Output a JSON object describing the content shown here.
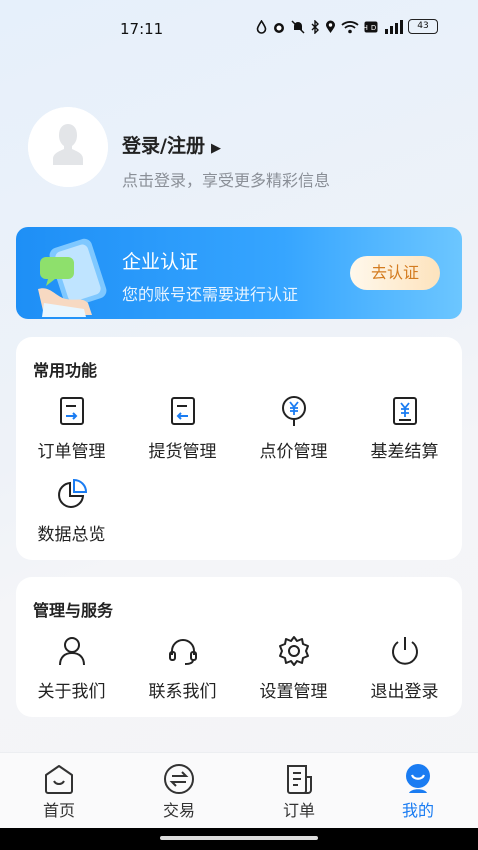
{
  "status_bar": {
    "time": "17:11",
    "battery": "43"
  },
  "profile": {
    "title": "登录/注册",
    "subtitle": "点击登录，享受更多精彩信息"
  },
  "verify": {
    "title": "企业认证",
    "desc": "您的账号还需要进行认证",
    "button": "去认证"
  },
  "common": {
    "title": "常用功能",
    "items": [
      {
        "label": "订单管理",
        "icon": "order-doc-icon"
      },
      {
        "label": "提货管理",
        "icon": "pickup-doc-icon"
      },
      {
        "label": "点价管理",
        "icon": "price-pin-icon"
      },
      {
        "label": "基差结算",
        "icon": "settlement-doc-icon"
      },
      {
        "label": "数据总览",
        "icon": "pie-chart-icon"
      }
    ]
  },
  "services": {
    "title": "管理与服务",
    "items": [
      {
        "label": "关于我们",
        "icon": "user-icon"
      },
      {
        "label": "联系我们",
        "icon": "headset-icon"
      },
      {
        "label": "设置管理",
        "icon": "gear-icon"
      },
      {
        "label": "退出登录",
        "icon": "power-icon"
      }
    ]
  },
  "tabs": [
    {
      "label": "首页",
      "icon": "home-icon"
    },
    {
      "label": "交易",
      "icon": "exchange-icon"
    },
    {
      "label": "订单",
      "icon": "order-icon"
    },
    {
      "label": "我的",
      "icon": "me-icon",
      "active": true
    }
  ],
  "colors": {
    "accent": "#1a7cf2",
    "card_bg": "#ffffff",
    "verify_btn_text": "#d37b1f"
  }
}
